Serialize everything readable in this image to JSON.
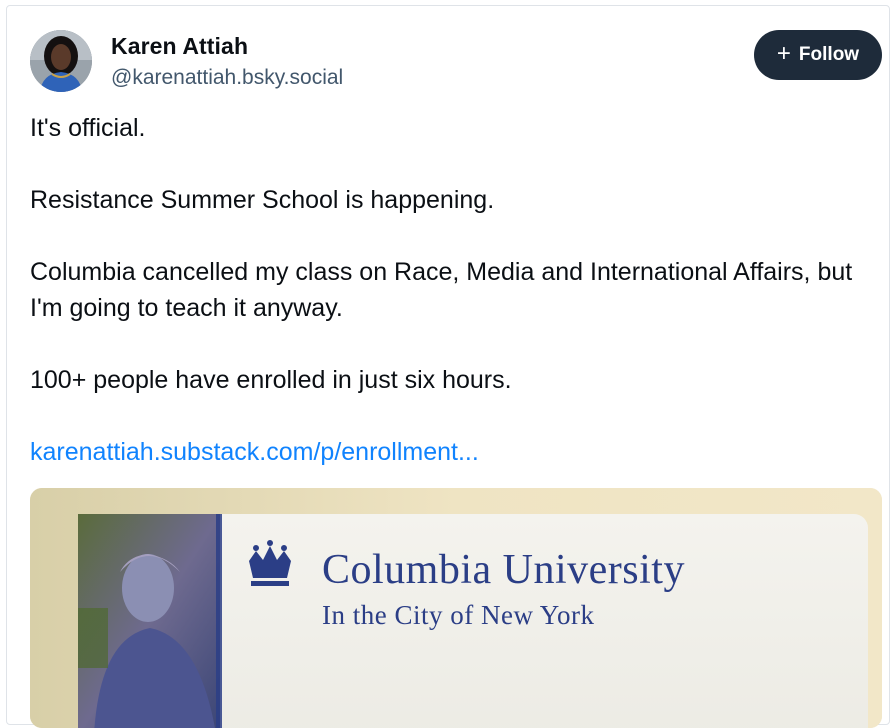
{
  "post": {
    "author": {
      "name": "Karen Attiah",
      "handle": "@karenattiah.bsky.social"
    },
    "follow_label": "Follow",
    "follow_icon": "plus-icon",
    "colors": {
      "follow_button_bg": "#1e2b3a",
      "link": "#1083fe",
      "text": "#0b0f14",
      "handle": "#42576c"
    },
    "paragraphs": [
      "It's official.",
      "Resistance Summer School is happening.",
      "Columbia cancelled my class on Race, Media and International Affairs, but I'm going to teach it anyway.",
      "100+ people have enrolled in just six hours."
    ],
    "link_text": "karenattiah.substack.com/p/enrollment...",
    "image": {
      "card_title": "Columbia University",
      "card_subtitle": "In the City of New York"
    }
  }
}
